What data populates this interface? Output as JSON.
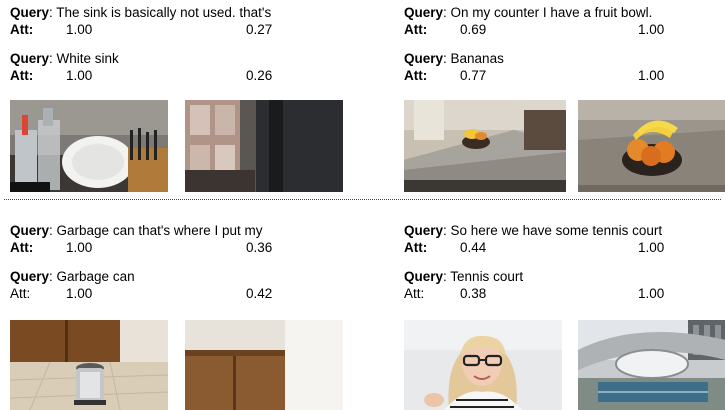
{
  "panels": [
    {
      "queries": [
        {
          "q_label": "Query",
          "q_text": ": The sink is basically not used. that's",
          "att_label": "Att:",
          "att_bold": true,
          "att1": "1.00",
          "att2": "0.27"
        },
        {
          "q_label": "Query",
          "q_text": ": White sink",
          "att_label": "Att:",
          "att_bold": true,
          "att1": "1.00",
          "att2": "0.26"
        }
      ]
    },
    {
      "queries": [
        {
          "q_label": "Query",
          "q_text": ": On my counter I have a fruit bowl.",
          "att_label": "Att:",
          "att_bold": true,
          "att1": "0.69",
          "att2": "1.00"
        },
        {
          "q_label": "Query",
          "q_text": ": Bananas",
          "att_label": "Att:",
          "att_bold": true,
          "att1": "0.77",
          "att2": "1.00"
        }
      ]
    },
    {
      "queries": [
        {
          "q_label": "Query",
          "q_text": ": Garbage can that's where I put my",
          "att_label": "Att:",
          "att_bold": true,
          "att1": "1.00",
          "att2": "0.36"
        },
        {
          "q_label": "Query",
          "q_text": ": Garbage can",
          "att_label": "Att:",
          "att_bold": false,
          "att1": "1.00",
          "att2": "0.42"
        }
      ]
    },
    {
      "queries": [
        {
          "q_label": "Query",
          "q_text": ": So here we have some tennis court",
          "att_label": "Att:",
          "att_bold": true,
          "att1": "0.44",
          "att2": "1.00"
        },
        {
          "q_label": "Query",
          "q_text": ": Tennis court",
          "att_label": "Att:",
          "att_bold": false,
          "att1": "0.38",
          "att2": "1.00"
        }
      ]
    }
  ]
}
